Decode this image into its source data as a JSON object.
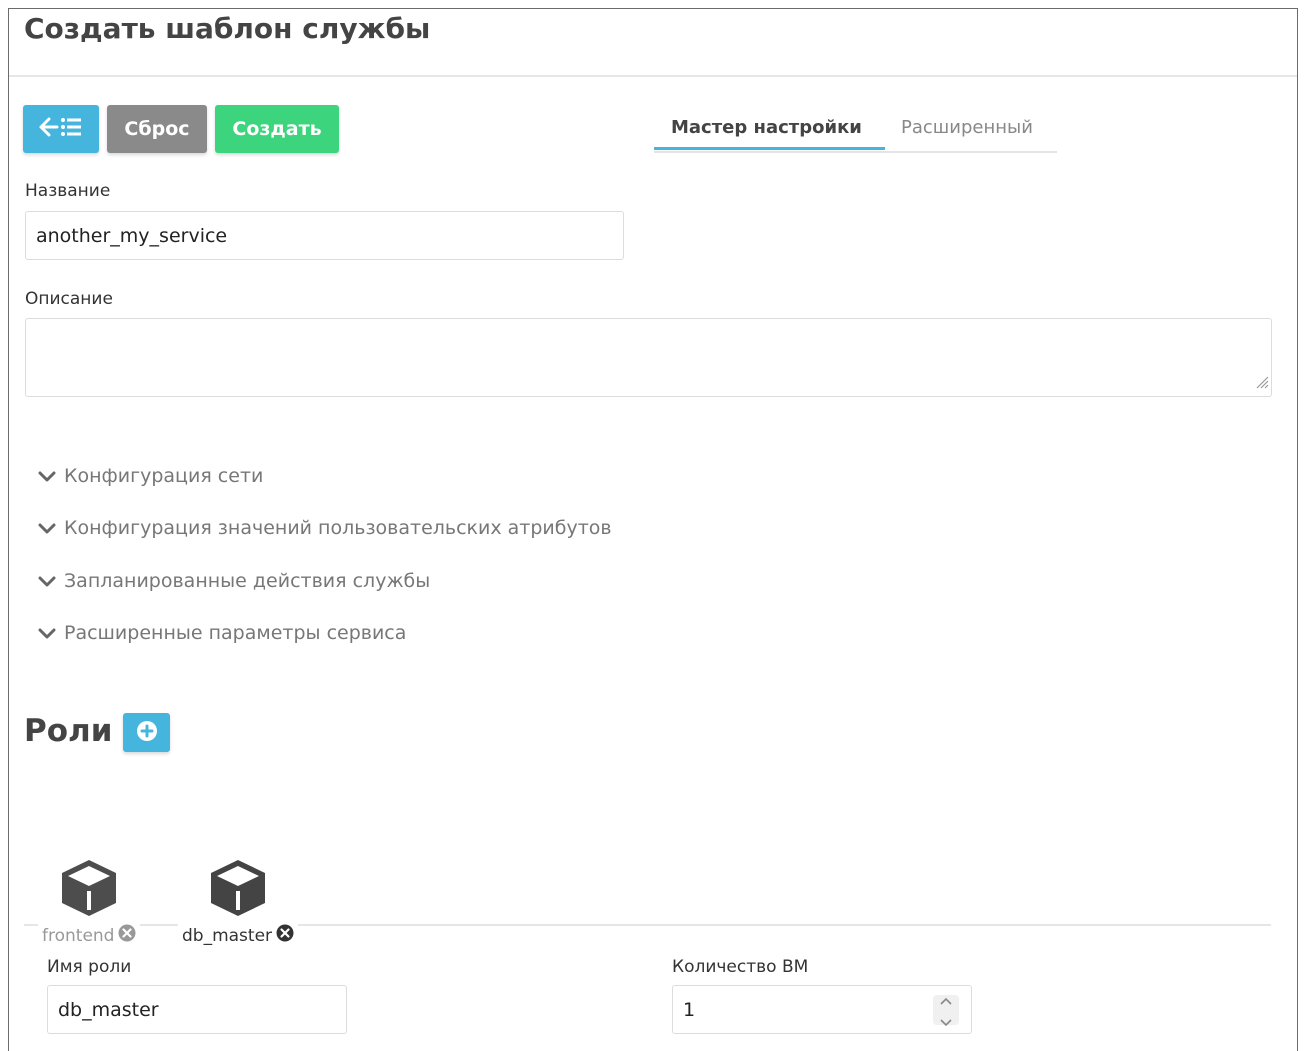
{
  "header": {
    "title": "Создать шаблон службы"
  },
  "toolbar": {
    "back_icon": "arrow-left-list-icon",
    "reset_label": "Сброс",
    "create_label": "Создать",
    "colors": {
      "back": "#45b5dd",
      "reset": "#8a8a8a",
      "create": "#3cd47c"
    }
  },
  "tabs": [
    {
      "label": "Мастер настройки",
      "active": true
    },
    {
      "label": "Расширенный",
      "active": false
    }
  ],
  "form": {
    "name": {
      "label": "Название",
      "value": "another_my_service"
    },
    "description": {
      "label": "Описание",
      "value": ""
    }
  },
  "sections": [
    {
      "label": "Конфигурация сети",
      "icon": "chevron-down-icon"
    },
    {
      "label": "Конфигурация значений пользовательских атрибутов",
      "icon": "chevron-down-icon"
    },
    {
      "label": "Запланированные действия службы",
      "icon": "chevron-down-icon"
    },
    {
      "label": "Расширенные параметры сервиса",
      "icon": "chevron-down-icon"
    }
  ],
  "roles": {
    "title": "Роли",
    "add_icon": "plus-circle-icon",
    "items": [
      {
        "name": "frontend",
        "icon": "cube-icon",
        "remove_icon": "close-circle-icon",
        "selected": false
      },
      {
        "name": "db_master",
        "icon": "cube-icon",
        "remove_icon": "close-circle-icon",
        "selected": true
      }
    ],
    "selected": {
      "role_name_label": "Имя роли",
      "role_name_value": "db_master",
      "vm_count_label": "Количество ВМ",
      "vm_count_value": "1"
    }
  }
}
